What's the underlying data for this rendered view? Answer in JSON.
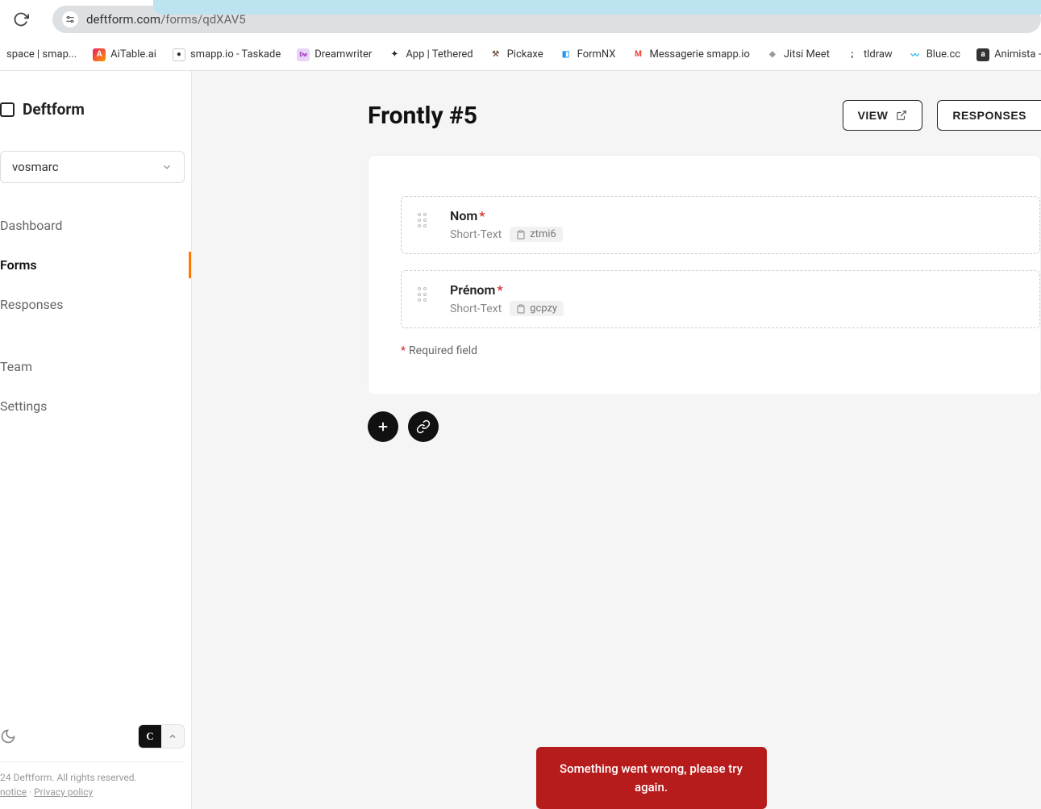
{
  "browser": {
    "url_host": "deftform.com",
    "url_path": "/forms/qdXAV5"
  },
  "bookmarks": [
    {
      "label": "space | smap...",
      "color": "#999"
    },
    {
      "label": "AiTable.ai",
      "color": "#e91e63"
    },
    {
      "label": "smapp.io - Taskade",
      "color": "#333"
    },
    {
      "label": "Dreamwriter",
      "color": "#9c27b0"
    },
    {
      "label": "App | Tethered",
      "color": "#222"
    },
    {
      "label": "Pickaxe",
      "color": "#795548"
    },
    {
      "label": "FormNX",
      "color": "#2196f3"
    },
    {
      "label": "Messagerie smapp.io",
      "color": "#ea4335"
    },
    {
      "label": "Jitsi Meet",
      "color": "#ccc"
    },
    {
      "label": "tldraw",
      "color": "#333"
    },
    {
      "label": "Blue.cc",
      "color": "#03a9f4"
    },
    {
      "label": "Animista - On-Dem...",
      "color": "#333"
    }
  ],
  "sidebar": {
    "brand": "Deftform",
    "workspace": "vosmarc",
    "nav": [
      {
        "label": "Dashboard"
      },
      {
        "label": "Forms"
      },
      {
        "label": "Responses"
      },
      {
        "label": "Team"
      },
      {
        "label": "Settings"
      }
    ],
    "theme_dark_label": "C",
    "copyright_line": "24 Deftform. All rights reserved.",
    "legal_notice": "notice",
    "legal_sep": " · ",
    "privacy": "Privacy policy"
  },
  "header": {
    "title": "Frontly #5",
    "view_label": "VIEW",
    "responses_label": "RESPONSES"
  },
  "form": {
    "fields": [
      {
        "label": "Nom",
        "required": true,
        "type": "Short-Text",
        "code": "ztmi6"
      },
      {
        "label": "Prénom",
        "required": true,
        "type": "Short-Text",
        "code": "gcpzy"
      }
    ],
    "required_note_star": "*",
    "required_note_text": "Required field"
  },
  "toast": {
    "message": "Something went wrong, please try again."
  }
}
